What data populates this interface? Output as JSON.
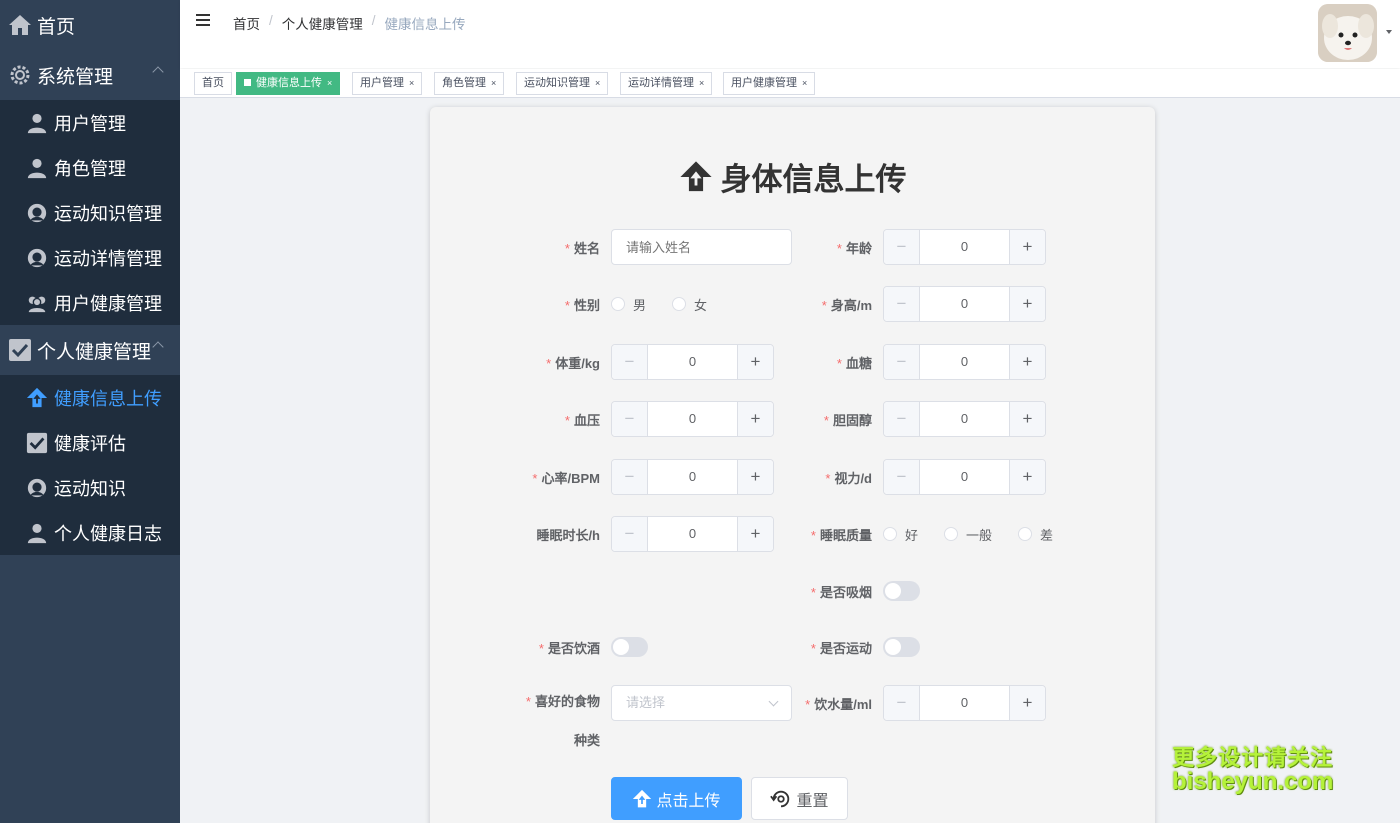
{
  "sidebar": {
    "home": "首页",
    "system": {
      "label": "系统管理",
      "items": [
        {
          "label": "用户管理",
          "icon": "user-icon"
        },
        {
          "label": "角色管理",
          "icon": "user-icon"
        },
        {
          "label": "运动知识管理",
          "icon": "face-icon"
        },
        {
          "label": "运动详情管理",
          "icon": "face-icon"
        },
        {
          "label": "用户健康管理",
          "icon": "group-icon"
        }
      ]
    },
    "personal": {
      "label": "个人健康管理",
      "items": [
        {
          "label": "健康信息上传",
          "icon": "upload-icon",
          "active": true
        },
        {
          "label": "健康评估",
          "icon": "checkbox-icon"
        },
        {
          "label": "运动知识",
          "icon": "face-icon"
        },
        {
          "label": "个人健康日志",
          "icon": "user-icon"
        }
      ]
    }
  },
  "header": {
    "breadcrumb": [
      "首页",
      "个人健康管理",
      "健康信息上传"
    ]
  },
  "tags": [
    {
      "label": "首页",
      "closable": false
    },
    {
      "label": "健康信息上传",
      "active": true
    },
    {
      "label": "用户管理"
    },
    {
      "label": "角色管理"
    },
    {
      "label": "运动知识管理"
    },
    {
      "label": "运动详情管理"
    },
    {
      "label": "用户健康管理"
    }
  ],
  "tag_close": "×",
  "form": {
    "title": "身体信息上传",
    "required_mark": "*",
    "name": {
      "label": "姓名",
      "placeholder": "请输入姓名"
    },
    "age": {
      "label": "年龄",
      "value": "0"
    },
    "gender": {
      "label": "性别",
      "options": [
        "男",
        "女"
      ]
    },
    "height": {
      "label": "身高/m",
      "value": "0"
    },
    "weight": {
      "label": "体重/kg",
      "value": "0"
    },
    "blood_sugar": {
      "label": "血糖",
      "value": "0"
    },
    "blood_pressure": {
      "label": "血压",
      "value": "0"
    },
    "cholesterol": {
      "label": "胆固醇",
      "value": "0"
    },
    "heart_rate": {
      "label": "心率/BPM",
      "value": "0"
    },
    "vision": {
      "label": "视力/d",
      "value": "0"
    },
    "sleep_hours": {
      "label": "睡眠时长/h",
      "value": "0"
    },
    "sleep_quality": {
      "label": "睡眠质量",
      "options": [
        "好",
        "一般",
        "差"
      ]
    },
    "smoking": {
      "label": "是否吸烟",
      "on": false
    },
    "drinking": {
      "label": "是否饮酒",
      "on": false
    },
    "exercise": {
      "label": "是否运动",
      "on": false
    },
    "food": {
      "label_line1": "喜好的食物",
      "label_line2": "种类",
      "placeholder": "请选择"
    },
    "water": {
      "label": "饮水量/ml",
      "value": "0"
    },
    "minus": "−",
    "plus": "+",
    "submit_label": "点击上传",
    "reset_label": "重置"
  },
  "watermark": {
    "line1": "更多设计请关注",
    "line2": "bisheyun.com"
  }
}
